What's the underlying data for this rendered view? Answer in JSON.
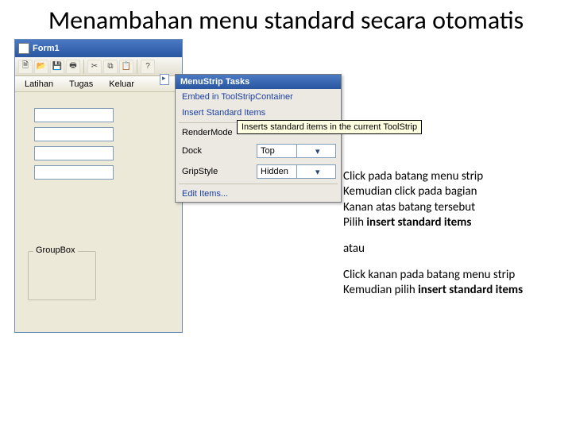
{
  "title": "Menambahan menu standard secara otomatis",
  "form": {
    "caption": "Form1",
    "menu": {
      "item1": "Latihan",
      "item2": "Tugas",
      "item3": "Keluar"
    },
    "groupbox": "GroupBox"
  },
  "tasks": {
    "header": "MenuStrip Tasks",
    "embed": "Embed in ToolStripContainer",
    "insert": "Insert Standard Items",
    "rendermode_label": "RenderMode",
    "dock_label": "Dock",
    "dock_value": "Top",
    "gripstyle_label": "GripStyle",
    "gripstyle_value": "Hidden",
    "edititems": "Edit Items..."
  },
  "tooltip": "Inserts standard items in the current ToolStrip",
  "instructions": {
    "l1": "Click pada batang menu strip",
    "l2": "Kemudian click pada bagian",
    "l3": "Kanan atas batang tersebut",
    "l4a": "Pilih ",
    "l4b": "insert standard items",
    "l5": "atau",
    "l6": "Click kanan pada batang menu strip",
    "l7a": "Kemudian pilih ",
    "l7b": "insert standard items"
  }
}
